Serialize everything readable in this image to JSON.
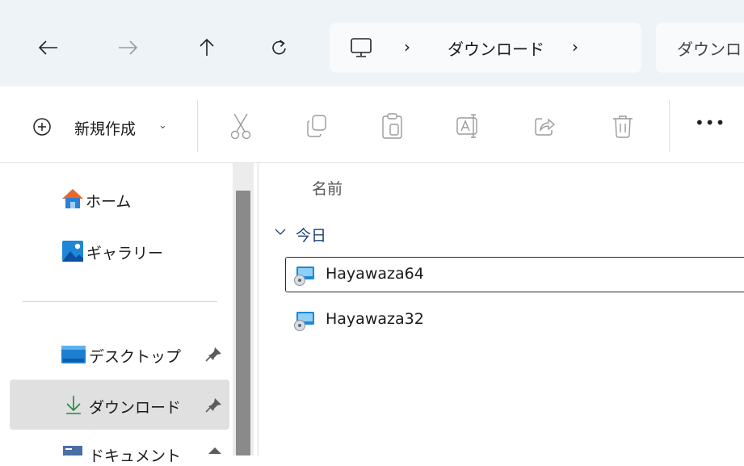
{
  "nav": {
    "back_icon": "arrow-left-icon",
    "forward_icon": "arrow-right-icon",
    "up_icon": "arrow-up-icon",
    "refresh_icon": "refresh-icon",
    "address": {
      "root_icon": "monitor-icon",
      "separator": "›",
      "crumbs": [
        "ダウンロード"
      ]
    },
    "search_placeholder": "ダウンロ"
  },
  "commandbar": {
    "new_label": "新規作成",
    "new_chevron": "⌄",
    "tools": [
      "cut-icon",
      "copy-icon",
      "paste-icon",
      "rename-icon",
      "share-icon",
      "delete-icon"
    ],
    "more_label": "•••"
  },
  "sidebar": {
    "items": [
      {
        "label": "ホーム",
        "icon": "home-icon"
      },
      {
        "label": "ギャラリー",
        "icon": "gallery-icon"
      },
      {
        "label": "デスクトップ",
        "icon": "desktop-folder-icon",
        "pinned": true
      },
      {
        "label": "ダウンロード",
        "icon": "download-icon",
        "pinned": true,
        "selected": true
      },
      {
        "label": "ドキュメント",
        "icon": "documents-icon",
        "pinned": true
      }
    ]
  },
  "content": {
    "column_name": "名前",
    "group_label": "今日",
    "files": [
      {
        "name": "Hayawaza64",
        "icon": "installer-icon",
        "focused": true
      },
      {
        "name": "Hayawaza32",
        "icon": "installer-icon",
        "focused": false
      }
    ]
  },
  "colors": {
    "nav_bg": "#eef3f8",
    "selection_bg": "#e0e0e0",
    "group_text": "#1f3f7a",
    "download_accent": "#1e8a3c",
    "home_roof": "#e8682a",
    "folder_blue": "#1e88d6"
  }
}
